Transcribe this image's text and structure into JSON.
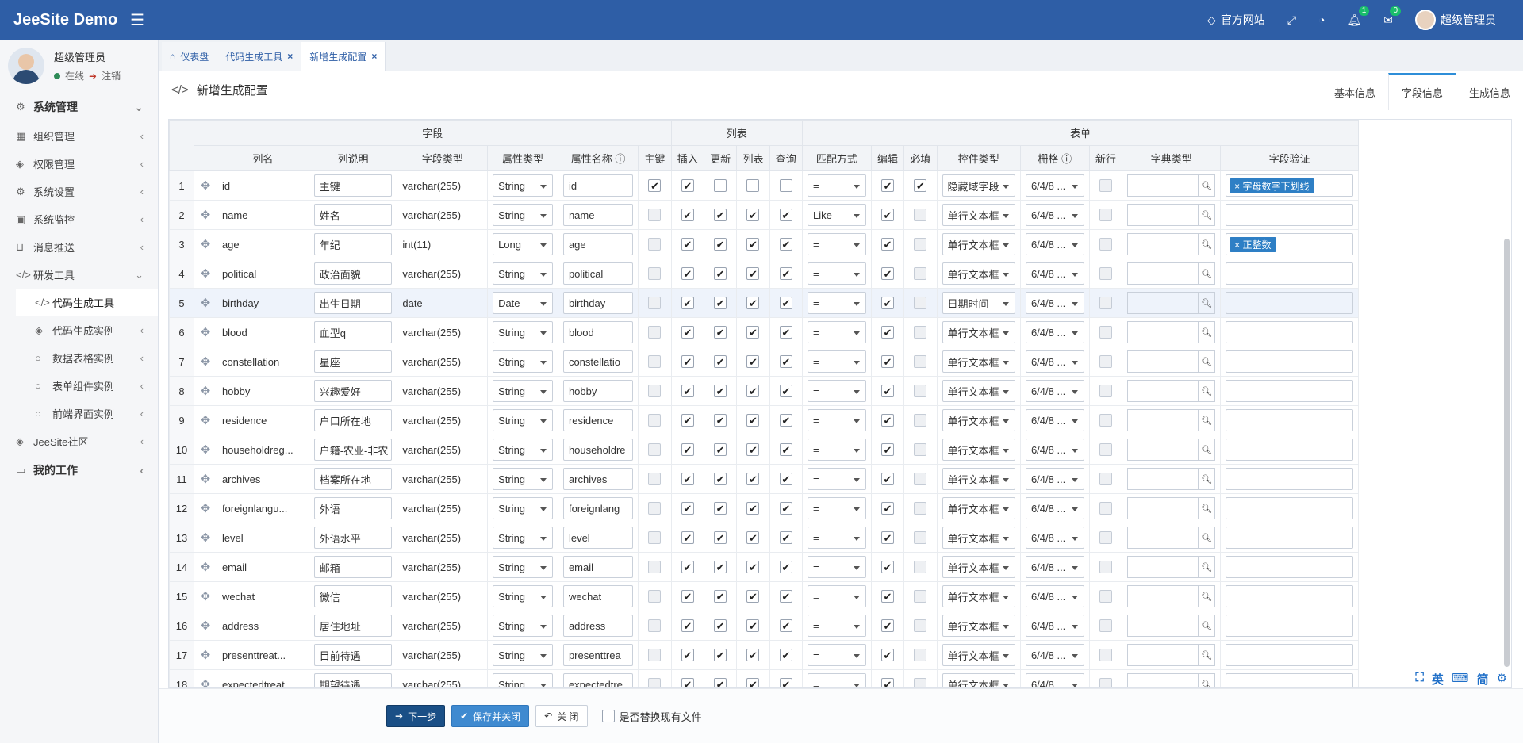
{
  "app": {
    "brand": "JeeSite Demo"
  },
  "topbar": {
    "official_site": "官方网站",
    "notif_badge": "1",
    "mail_badge": "0",
    "username": "超级管理员"
  },
  "sidebar": {
    "user_name": "超级管理员",
    "status_online": "在线",
    "logout": "注销",
    "items": [
      {
        "label": "系统管理",
        "icon": "gear-icon"
      },
      {
        "label": "组织管理",
        "icon": "grid-icon"
      },
      {
        "label": "权限管理",
        "icon": "layers-icon"
      },
      {
        "label": "系统设置",
        "icon": "gear-icon"
      },
      {
        "label": "系统监控",
        "icon": "monitor-icon"
      },
      {
        "label": "消息推送",
        "icon": "inbox-icon"
      },
      {
        "label": "研发工具",
        "icon": "code-icon"
      },
      {
        "label": "代码生成工具",
        "icon": "code-icon"
      },
      {
        "label": "代码生成实例",
        "icon": "layers-icon"
      },
      {
        "label": "数据表格实例",
        "icon": "circle-icon"
      },
      {
        "label": "表单组件实例",
        "icon": "circle-icon"
      },
      {
        "label": "前端界面实例",
        "icon": "circle-icon"
      },
      {
        "label": "JeeSite社区",
        "icon": "layers-icon"
      },
      {
        "label": "我的工作",
        "icon": "desktop-icon"
      }
    ]
  },
  "tabs": [
    {
      "label": "仪表盘"
    },
    {
      "label": "代码生成工具"
    },
    {
      "label": "新增生成配置"
    }
  ],
  "page": {
    "title": "新增生成配置",
    "subtabs": [
      "基本信息",
      "字段信息",
      "生成信息"
    ]
  },
  "grid": {
    "groups": [
      "字段",
      "列表",
      "表单"
    ],
    "headers": [
      "列名",
      "列说明",
      "字段类型",
      "属性类型",
      "属性名称",
      "主键",
      "插入",
      "更新",
      "列表",
      "查询",
      "匹配方式",
      "编辑",
      "必填",
      "控件类型",
      "栅格",
      "新行",
      "字典类型",
      "字段验证"
    ],
    "rows": [
      {
        "no": "1",
        "name": "id",
        "comment": "主键",
        "jdbc": "varchar(255)",
        "ptype": "String",
        "pname": "id",
        "match": "=",
        "ctrl": "隐藏域字段",
        "grid": "6/4/8 ...",
        "valid": "字母数字下划线"
      },
      {
        "no": "2",
        "name": "name",
        "comment": "姓名",
        "jdbc": "varchar(255)",
        "ptype": "String",
        "pname": "name",
        "match": "Like",
        "ctrl": "单行文本框",
        "grid": "6/4/8 ...",
        "valid": ""
      },
      {
        "no": "3",
        "name": "age",
        "comment": "年纪",
        "jdbc": "int(11)",
        "ptype": "Long",
        "pname": "age",
        "match": "=",
        "ctrl": "单行文本框",
        "grid": "6/4/8 ...",
        "valid": "正整数"
      },
      {
        "no": "4",
        "name": "political",
        "comment": "政治面貌",
        "jdbc": "varchar(255)",
        "ptype": "String",
        "pname": "political",
        "match": "=",
        "ctrl": "单行文本框",
        "grid": "6/4/8 ...",
        "valid": ""
      },
      {
        "no": "5",
        "name": "birthday",
        "comment": "出生日期",
        "jdbc": "date",
        "ptype": "Date",
        "pname": "birthday",
        "match": "=",
        "ctrl": "日期时间",
        "grid": "6/4/8 ...",
        "valid": ""
      },
      {
        "no": "6",
        "name": "blood",
        "comment": "血型q",
        "jdbc": "varchar(255)",
        "ptype": "String",
        "pname": "blood",
        "match": "=",
        "ctrl": "单行文本框",
        "grid": "6/4/8 ...",
        "valid": ""
      },
      {
        "no": "7",
        "name": "constellation",
        "comment": "星座",
        "jdbc": "varchar(255)",
        "ptype": "String",
        "pname": "constellatio",
        "match": "=",
        "ctrl": "单行文本框",
        "grid": "6/4/8 ...",
        "valid": ""
      },
      {
        "no": "8",
        "name": "hobby",
        "comment": "兴趣爱好",
        "jdbc": "varchar(255)",
        "ptype": "String",
        "pname": "hobby",
        "match": "=",
        "ctrl": "单行文本框",
        "grid": "6/4/8 ...",
        "valid": ""
      },
      {
        "no": "9",
        "name": "residence",
        "comment": "户口所在地",
        "jdbc": "varchar(255)",
        "ptype": "String",
        "pname": "residence",
        "match": "=",
        "ctrl": "单行文本框",
        "grid": "6/4/8 ...",
        "valid": ""
      },
      {
        "no": "10",
        "name": "householdreg...",
        "comment": "户籍-农业-非农",
        "jdbc": "varchar(255)",
        "ptype": "String",
        "pname": "householdre",
        "match": "=",
        "ctrl": "单行文本框",
        "grid": "6/4/8 ...",
        "valid": ""
      },
      {
        "no": "11",
        "name": "archives",
        "comment": "档案所在地",
        "jdbc": "varchar(255)",
        "ptype": "String",
        "pname": "archives",
        "match": "=",
        "ctrl": "单行文本框",
        "grid": "6/4/8 ...",
        "valid": ""
      },
      {
        "no": "12",
        "name": "foreignlangu...",
        "comment": "外语",
        "jdbc": "varchar(255)",
        "ptype": "String",
        "pname": "foreignlang",
        "match": "=",
        "ctrl": "单行文本框",
        "grid": "6/4/8 ...",
        "valid": ""
      },
      {
        "no": "13",
        "name": "level",
        "comment": "外语水平",
        "jdbc": "varchar(255)",
        "ptype": "String",
        "pname": "level",
        "match": "=",
        "ctrl": "单行文本框",
        "grid": "6/4/8 ...",
        "valid": ""
      },
      {
        "no": "14",
        "name": "email",
        "comment": "邮箱",
        "jdbc": "varchar(255)",
        "ptype": "String",
        "pname": "email",
        "match": "=",
        "ctrl": "单行文本框",
        "grid": "6/4/8 ...",
        "valid": ""
      },
      {
        "no": "15",
        "name": "wechat",
        "comment": "微信",
        "jdbc": "varchar(255)",
        "ptype": "String",
        "pname": "wechat",
        "match": "=",
        "ctrl": "单行文本框",
        "grid": "6/4/8 ...",
        "valid": ""
      },
      {
        "no": "16",
        "name": "address",
        "comment": "居住地址",
        "jdbc": "varchar(255)",
        "ptype": "String",
        "pname": "address",
        "match": "=",
        "ctrl": "单行文本框",
        "grid": "6/4/8 ...",
        "valid": ""
      },
      {
        "no": "17",
        "name": "presenttreat...",
        "comment": "目前待遇",
        "jdbc": "varchar(255)",
        "ptype": "String",
        "pname": "presenttrea",
        "match": "=",
        "ctrl": "单行文本框",
        "grid": "6/4/8 ...",
        "valid": ""
      },
      {
        "no": "18",
        "name": "expectedtreat...",
        "comment": "期望待遇",
        "jdbc": "varchar(255)",
        "ptype": "String",
        "pname": "expectedtre",
        "match": "=",
        "ctrl": "单行文本框",
        "grid": "6/4/8 ...",
        "valid": ""
      }
    ]
  },
  "footer": {
    "next": "下一步",
    "save_close": "保存并关闭",
    "close": "关 闭",
    "replace_files": "是否替换现有文件"
  },
  "ime": [
    "英",
    "简"
  ]
}
